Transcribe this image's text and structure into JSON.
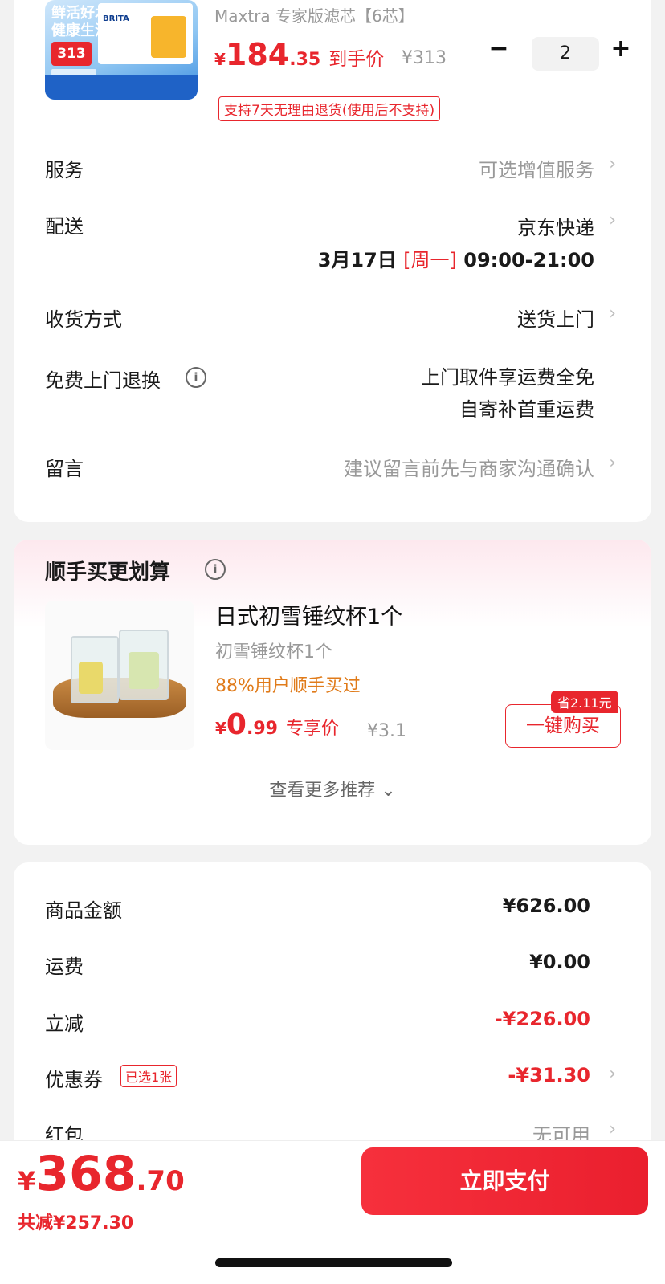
{
  "product": {
    "title": "Maxtra 专家版滤芯【6芯】",
    "image_tag_line1": "鲜活好水",
    "image_tag_line2": "健康生活",
    "image_price": "313",
    "image_brand": "BRITA",
    "price_yen": "¥",
    "price_int": "184",
    "price_dec": ".35",
    "price_label": "到手价",
    "price_orig": "¥313",
    "qty_minus": "−",
    "qty": "2",
    "qty_plus": "+",
    "return_tag": "支持7天无理由退货(使用后不支持)"
  },
  "rows": {
    "service_label": "服务",
    "service_value": "可选增值服务",
    "delivery_label": "配送",
    "delivery_value": "京东快递",
    "delivery_date": "3月17日",
    "delivery_weekday": "[周一]",
    "delivery_time": "09:00-21:00",
    "receive_label": "收货方式",
    "receive_value": "送货上门",
    "return_label": "免费上门退换",
    "return_value_1": "上门取件享运费全免",
    "return_value_2": "自寄补首重运费",
    "message_label": "留言",
    "message_value": "建议留言前先与商家沟通确认",
    "chevron": "›",
    "info": "i"
  },
  "recommend": {
    "section_title": "顺手买更划算",
    "title": "日式初雪锤纹杯1个",
    "subtitle": "初雪锤纹杯1个",
    "percent": "88%用户顺手买过",
    "price_yen": "¥",
    "price_int": "0",
    "price_dec": ".99",
    "price_label": "专享价",
    "price_orig": "¥3.1",
    "save_badge": "省2.11元",
    "buy_label": "一键购买",
    "more_label": "查看更多推荐 ⌄"
  },
  "summary": {
    "goods_label": "商品金额",
    "goods_value": "¥626.00",
    "shipping_label": "运费",
    "shipping_value": "¥0.00",
    "discount_label": "立减",
    "discount_value": "-¥226.00",
    "coupon_label": "优惠券",
    "coupon_tag": "已选1张",
    "coupon_value": "-¥31.30",
    "redpack_label": "红包",
    "redpack_value": "无可用"
  },
  "footer": {
    "total_yen": "¥",
    "total_int": "368",
    "total_dec": ".70",
    "total_save": "共减¥257.30",
    "pay_label": "立即支付"
  },
  "colors": {
    "accent": "#e8262d",
    "orange": "#e07b1a",
    "gray_text": "#999999"
  }
}
